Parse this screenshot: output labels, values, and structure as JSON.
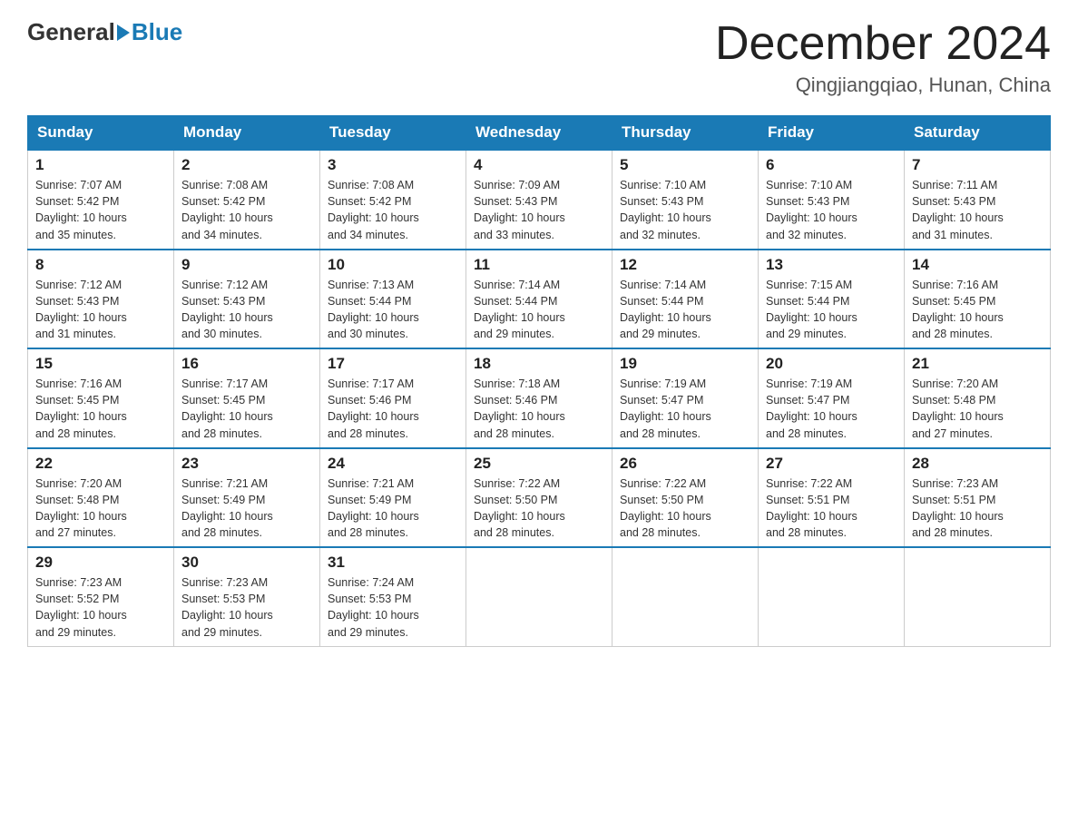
{
  "header": {
    "logo_general": "General",
    "logo_blue": "Blue",
    "month_title": "December 2024",
    "location": "Qingjiangqiao, Hunan, China"
  },
  "days_of_week": [
    "Sunday",
    "Monday",
    "Tuesday",
    "Wednesday",
    "Thursday",
    "Friday",
    "Saturday"
  ],
  "weeks": [
    [
      {
        "day": "1",
        "sunrise": "7:07 AM",
        "sunset": "5:42 PM",
        "daylight": "10 hours and 35 minutes."
      },
      {
        "day": "2",
        "sunrise": "7:08 AM",
        "sunset": "5:42 PM",
        "daylight": "10 hours and 34 minutes."
      },
      {
        "day": "3",
        "sunrise": "7:08 AM",
        "sunset": "5:42 PM",
        "daylight": "10 hours and 34 minutes."
      },
      {
        "day": "4",
        "sunrise": "7:09 AM",
        "sunset": "5:43 PM",
        "daylight": "10 hours and 33 minutes."
      },
      {
        "day": "5",
        "sunrise": "7:10 AM",
        "sunset": "5:43 PM",
        "daylight": "10 hours and 32 minutes."
      },
      {
        "day": "6",
        "sunrise": "7:10 AM",
        "sunset": "5:43 PM",
        "daylight": "10 hours and 32 minutes."
      },
      {
        "day": "7",
        "sunrise": "7:11 AM",
        "sunset": "5:43 PM",
        "daylight": "10 hours and 31 minutes."
      }
    ],
    [
      {
        "day": "8",
        "sunrise": "7:12 AM",
        "sunset": "5:43 PM",
        "daylight": "10 hours and 31 minutes."
      },
      {
        "day": "9",
        "sunrise": "7:12 AM",
        "sunset": "5:43 PM",
        "daylight": "10 hours and 30 minutes."
      },
      {
        "day": "10",
        "sunrise": "7:13 AM",
        "sunset": "5:44 PM",
        "daylight": "10 hours and 30 minutes."
      },
      {
        "day": "11",
        "sunrise": "7:14 AM",
        "sunset": "5:44 PM",
        "daylight": "10 hours and 29 minutes."
      },
      {
        "day": "12",
        "sunrise": "7:14 AM",
        "sunset": "5:44 PM",
        "daylight": "10 hours and 29 minutes."
      },
      {
        "day": "13",
        "sunrise": "7:15 AM",
        "sunset": "5:44 PM",
        "daylight": "10 hours and 29 minutes."
      },
      {
        "day": "14",
        "sunrise": "7:16 AM",
        "sunset": "5:45 PM",
        "daylight": "10 hours and 28 minutes."
      }
    ],
    [
      {
        "day": "15",
        "sunrise": "7:16 AM",
        "sunset": "5:45 PM",
        "daylight": "10 hours and 28 minutes."
      },
      {
        "day": "16",
        "sunrise": "7:17 AM",
        "sunset": "5:45 PM",
        "daylight": "10 hours and 28 minutes."
      },
      {
        "day": "17",
        "sunrise": "7:17 AM",
        "sunset": "5:46 PM",
        "daylight": "10 hours and 28 minutes."
      },
      {
        "day": "18",
        "sunrise": "7:18 AM",
        "sunset": "5:46 PM",
        "daylight": "10 hours and 28 minutes."
      },
      {
        "day": "19",
        "sunrise": "7:19 AM",
        "sunset": "5:47 PM",
        "daylight": "10 hours and 28 minutes."
      },
      {
        "day": "20",
        "sunrise": "7:19 AM",
        "sunset": "5:47 PM",
        "daylight": "10 hours and 28 minutes."
      },
      {
        "day": "21",
        "sunrise": "7:20 AM",
        "sunset": "5:48 PM",
        "daylight": "10 hours and 27 minutes."
      }
    ],
    [
      {
        "day": "22",
        "sunrise": "7:20 AM",
        "sunset": "5:48 PM",
        "daylight": "10 hours and 27 minutes."
      },
      {
        "day": "23",
        "sunrise": "7:21 AM",
        "sunset": "5:49 PM",
        "daylight": "10 hours and 28 minutes."
      },
      {
        "day": "24",
        "sunrise": "7:21 AM",
        "sunset": "5:49 PM",
        "daylight": "10 hours and 28 minutes."
      },
      {
        "day": "25",
        "sunrise": "7:22 AM",
        "sunset": "5:50 PM",
        "daylight": "10 hours and 28 minutes."
      },
      {
        "day": "26",
        "sunrise": "7:22 AM",
        "sunset": "5:50 PM",
        "daylight": "10 hours and 28 minutes."
      },
      {
        "day": "27",
        "sunrise": "7:22 AM",
        "sunset": "5:51 PM",
        "daylight": "10 hours and 28 minutes."
      },
      {
        "day": "28",
        "sunrise": "7:23 AM",
        "sunset": "5:51 PM",
        "daylight": "10 hours and 28 minutes."
      }
    ],
    [
      {
        "day": "29",
        "sunrise": "7:23 AM",
        "sunset": "5:52 PM",
        "daylight": "10 hours and 29 minutes."
      },
      {
        "day": "30",
        "sunrise": "7:23 AM",
        "sunset": "5:53 PM",
        "daylight": "10 hours and 29 minutes."
      },
      {
        "day": "31",
        "sunrise": "7:24 AM",
        "sunset": "5:53 PM",
        "daylight": "10 hours and 29 minutes."
      },
      null,
      null,
      null,
      null
    ]
  ],
  "labels": {
    "sunrise_prefix": "Sunrise: ",
    "sunset_prefix": "Sunset: ",
    "daylight_prefix": "Daylight: "
  }
}
